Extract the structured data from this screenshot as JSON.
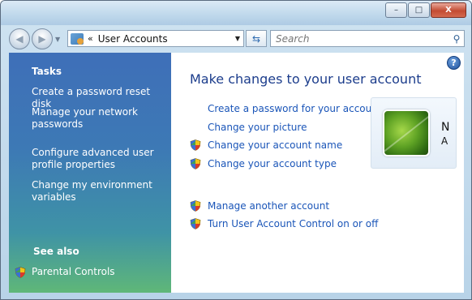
{
  "window": {
    "buttons": {
      "minimize": "–",
      "maximize": "□",
      "close": "X"
    }
  },
  "navigation": {
    "address_path": "User Accounts",
    "address_chevron": "«",
    "search_placeholder": "Search"
  },
  "sidebar": {
    "tasks_heading": "Tasks",
    "tasks": [
      "Create a password reset disk",
      "Manage your network passwords",
      "Configure advanced user profile properties",
      "Change my environment variables"
    ],
    "see_also_heading": "See also",
    "see_also": [
      "Parental Controls"
    ]
  },
  "main": {
    "title": "Make changes to your user account",
    "help": "?",
    "tasks": [
      "Create a password for your account",
      "Change your picture",
      "Change your account name",
      "Change your account type"
    ],
    "other_tasks": [
      "Manage another account",
      "Turn User Account Control on or off"
    ]
  },
  "user_card": {
    "name_initial": "N",
    "type_initial": "A"
  },
  "colors": {
    "link": "#1a55b8",
    "title": "#1c3d8c",
    "sidebar_top": "#3e6fb8",
    "sidebar_bottom": "#5fb778"
  }
}
